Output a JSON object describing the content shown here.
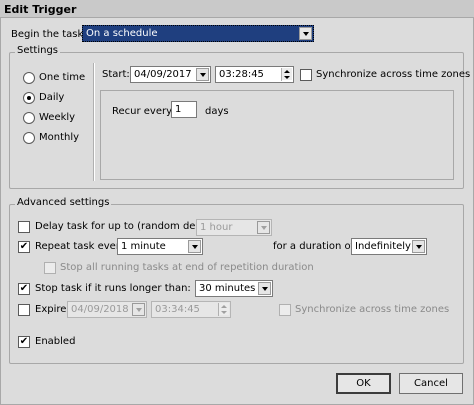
{
  "window": {
    "title": "Edit Trigger"
  },
  "begin_task": {
    "label": "Begin the task:",
    "value": "On a schedule"
  },
  "settings": {
    "group_label": "Settings",
    "schedule_options": [
      {
        "label": "One time",
        "selected": false
      },
      {
        "label": "Daily",
        "selected": true
      },
      {
        "label": "Weekly",
        "selected": false
      },
      {
        "label": "Monthly",
        "selected": false
      }
    ],
    "start_label": "Start:",
    "start_date": "04/09/2017",
    "start_time": "03:28:45",
    "sync_label": "Synchronize across time zones",
    "sync_checked": false,
    "recur_label": "Recur every:",
    "recur_value": "1",
    "recur_unit": "days"
  },
  "advanced": {
    "group_label": "Advanced settings",
    "delay": {
      "label": "Delay task for up to (random delay):",
      "checked": false,
      "value": "1 hour"
    },
    "repeat": {
      "label": "Repeat task every:",
      "checked": true,
      "value": "1 minute",
      "duration_label": "for a duration of:",
      "duration_value": "Indefinitely"
    },
    "stop_running": {
      "label": "Stop all running tasks at end of repetition duration",
      "checked": false
    },
    "stop_longer": {
      "label": "Stop task if it runs longer than:",
      "checked": true,
      "value": "30 minutes"
    },
    "expire": {
      "label": "Expire:",
      "checked": false,
      "date": "04/09/2018",
      "time": "03:34:45",
      "sync_label": "Synchronize across time zones",
      "sync_checked": false
    },
    "enabled": {
      "label": "Enabled",
      "checked": true
    }
  },
  "buttons": {
    "ok": "OK",
    "cancel": "Cancel"
  }
}
